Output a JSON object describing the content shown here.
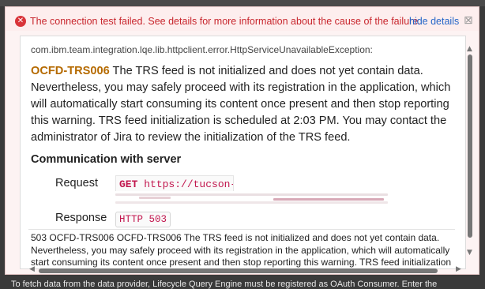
{
  "error_banner": {
    "icon": "error-x-icon",
    "message": "The connection test failed. See details for more information about the cause of the failure.",
    "hide_link": "hide details",
    "close_glyph": "⊠"
  },
  "details": {
    "exception": "com.ibm.team.integration.lqe.lib.httpclient.error.HttpServiceUnavailableException:",
    "code": "OCFD-TRS006",
    "message": "The TRS feed is not initialized and does not yet contain data. Nevertheless, you may safely proceed with its registration in the application, which will automatically start consuming its content once present and then stop reporting this warning. TRS feed initialization is scheduled at 2:03 PM. You may contact the administrator of Jira to review the initialization of the TRS feed.",
    "communication_title": "Communication with server",
    "request_label": "Request",
    "request_method": "GET",
    "request_url": "https://tucson-",
    "response_label": "Response",
    "response_status": "HTTP 503",
    "response_body": "503 OCFD-TRS006 OCFD-TRS006 The TRS feed is not initialized and does not yet contain data. Nevertheless, you may safely proceed with its registration in the application, which will automatically start consuming its content once present and then stop reporting this warning. TRS feed initialization is"
  },
  "background_text": "To fetch data from the data provider, Lifecycle Query Engine must be registered as OAuth Consumer. Enter the",
  "colors": {
    "error": "#c8262d",
    "link": "#2566c8",
    "code": "#b56a00",
    "mono": "#c2174e"
  }
}
